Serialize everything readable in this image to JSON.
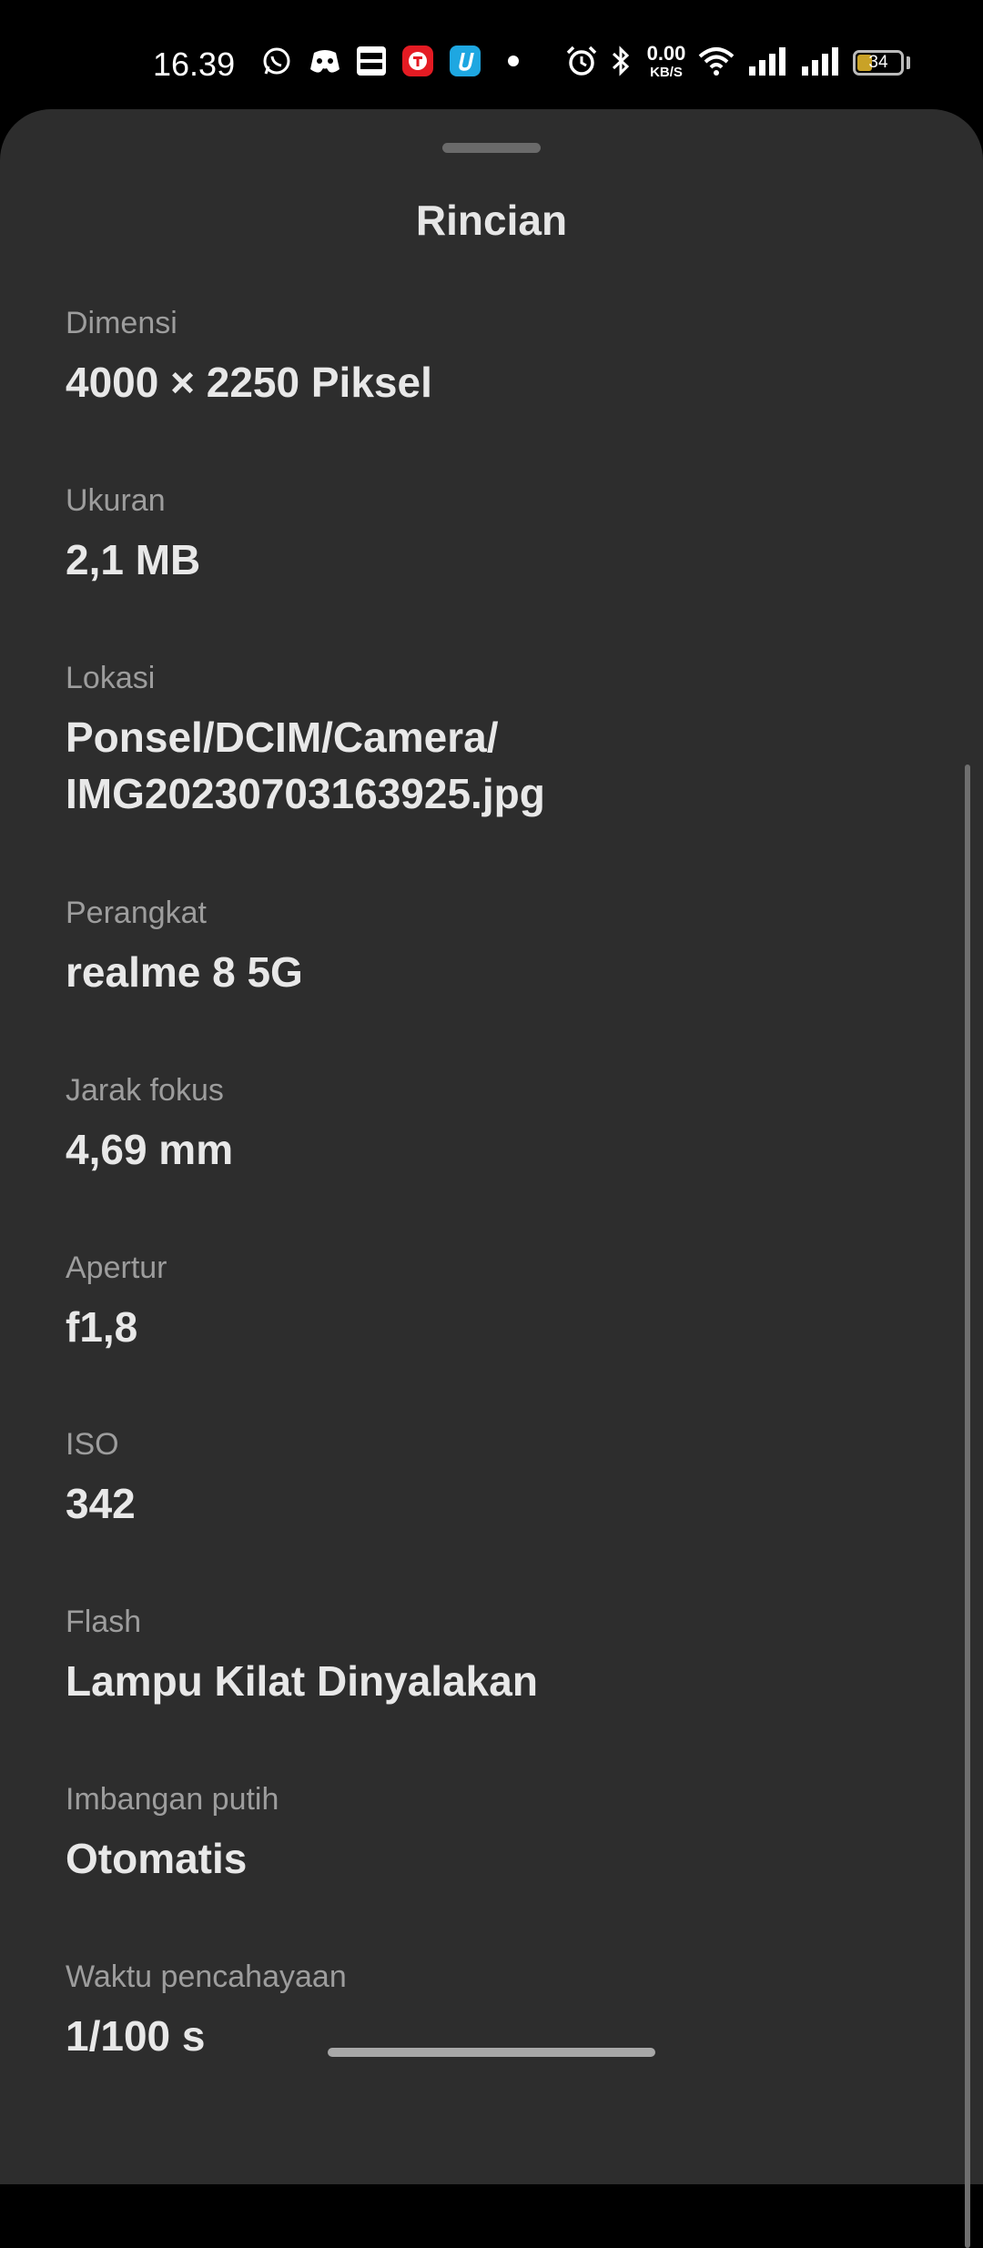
{
  "status_bar": {
    "time": "16.39",
    "notification_icons": [
      "whatsapp-icon",
      "discord-icon",
      "brimo-icon",
      "telkomsel-icon",
      "uang-icon",
      "more-dot-icon"
    ],
    "speed_value": "0.00",
    "speed_unit": "KB/S",
    "battery_level": "34",
    "battery_color": "#c9a227"
  },
  "sheet": {
    "title": "Rincian",
    "details": [
      {
        "label": "Dimensi",
        "value": "4000 × 2250 Piksel"
      },
      {
        "label": "Ukuran",
        "value": "2,1 MB"
      },
      {
        "label": "Lokasi",
        "value": "Ponsel/DCIM/Camera/",
        "value_line2": "IMG20230703163925.jpg"
      },
      {
        "label": "Perangkat",
        "value": "realme 8 5G"
      },
      {
        "label": "Jarak fokus",
        "value": "4,69 mm"
      },
      {
        "label": "Apertur",
        "value": "f1,8"
      },
      {
        "label": "ISO",
        "value": "342"
      },
      {
        "label": "Flash",
        "value": "Lampu Kilat Dinyalakan"
      },
      {
        "label": "Imbangan putih",
        "value": "Otomatis"
      },
      {
        "label": "Waktu pencahayaan",
        "value": "1/100 s"
      }
    ]
  },
  "colors": {
    "sheet_background": "#2d2d2d",
    "label_text": "#9d9d9d",
    "value_text": "#e8e8e8"
  }
}
